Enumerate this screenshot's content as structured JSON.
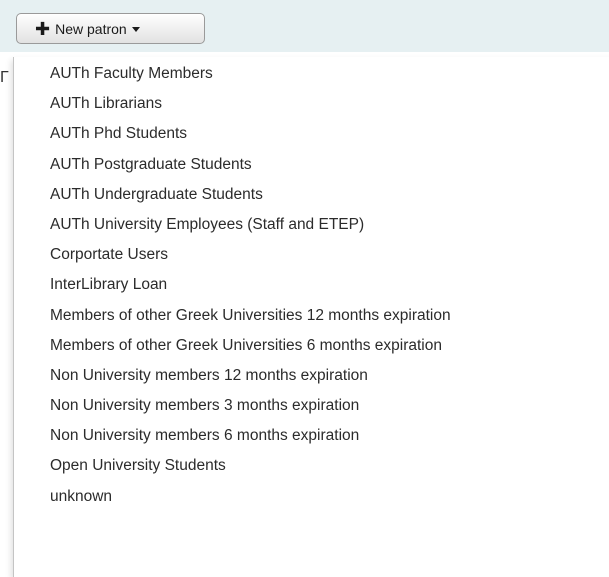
{
  "toolbar": {
    "new_patron_label": "New patron",
    "bg_color": "#e6f0f2"
  },
  "background": {
    "fragment": "Г"
  },
  "menu": {
    "items": [
      {
        "label": "AUTh Faculty Members"
      },
      {
        "label": "AUTh Librarians"
      },
      {
        "label": "AUTh Phd Students"
      },
      {
        "label": "AUTh Postgraduate Students"
      },
      {
        "label": "AUTh Undergraduate Students"
      },
      {
        "label": "AUTh University Employees (Staff and ETEP)"
      },
      {
        "label": "Corportate Users"
      },
      {
        "label": "InterLibrary Loan"
      },
      {
        "label": "Members of other Greek Universities 12 months expiration"
      },
      {
        "label": "Members of other Greek Universities 6 months expiration"
      },
      {
        "label": "Non University members 12 months expiration"
      },
      {
        "label": "Non University members 3 months expiration"
      },
      {
        "label": "Non University members 6 months expiration"
      },
      {
        "label": "Open University Students"
      },
      {
        "label": "unknown"
      }
    ]
  },
  "icons": {
    "plus": "plus-icon",
    "caret": "caret-down-icon"
  }
}
